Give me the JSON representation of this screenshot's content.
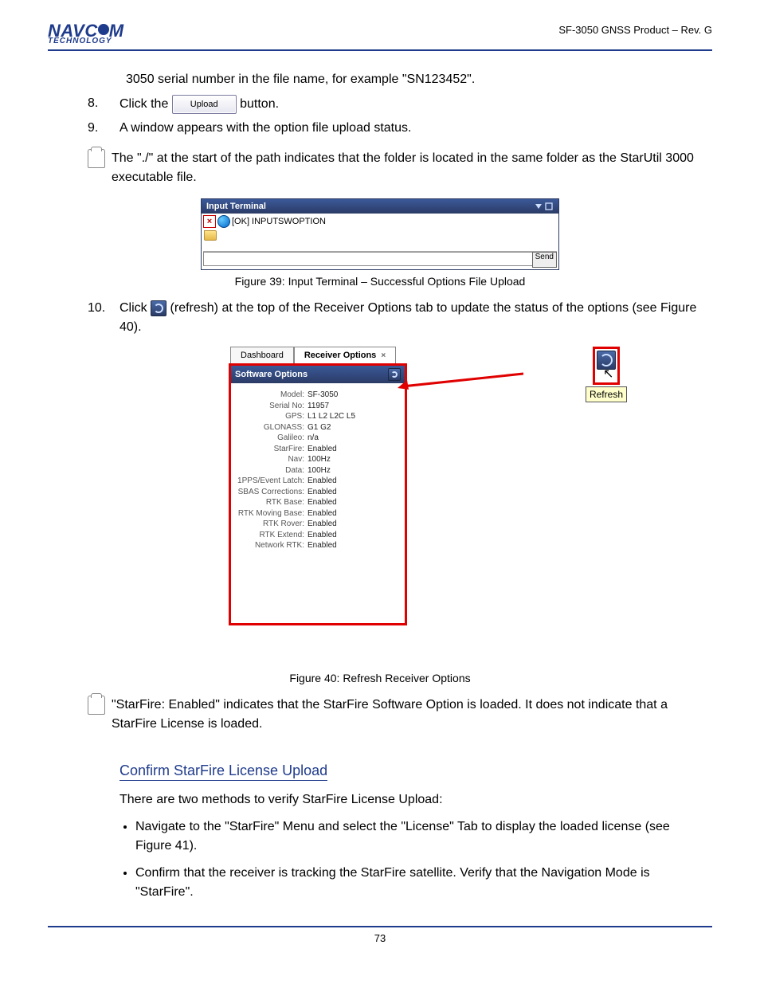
{
  "header": {
    "logo_top": "NAVC",
    "logo_top2": "M",
    "logo_bot": "TECHNOLOGY",
    "right": "SF-3050 GNSS Product – Rev. G"
  },
  "intro": "3050 serial number in the file name, for example \"SN123452\".",
  "steps": {
    "s8": {
      "num": "8.",
      "pre": "Click the ",
      "btn": "Upload",
      "post": " button."
    },
    "s9": {
      "num": "9.",
      "text": "A window appears with the option file upload status."
    },
    "s10": {
      "num": "10.",
      "text": "Click      (refresh) at the top of the Receiver Options tab to update the status of the options (see Figure 40)."
    }
  },
  "note1": "The \"./\" at the start of the path indicates that the folder is located in the same folder as the StarUtil 3000 executable file.",
  "fig39_caption": "Figure 39: Input Terminal – Successful Options File Upload",
  "terminal": {
    "title": "Input Terminal",
    "line1": "[OK] INPUTSWOPTION",
    "send": "Send"
  },
  "fig40_caption": "Figure 40: Refresh Receiver Options",
  "tabs": {
    "t1": "Dashboard",
    "t2": "Receiver Options"
  },
  "opt_title": "Software Options",
  "callout_label": "Refresh",
  "opts": [
    {
      "k": "Model:",
      "v": "SF-3050"
    },
    {
      "k": "Serial No:",
      "v": "11957"
    },
    {
      "k": "GPS:",
      "v": "L1 L2 L2C L5"
    },
    {
      "k": "GLONASS:",
      "v": "G1 G2"
    },
    {
      "k": "Galileo:",
      "v": "n/a"
    },
    {
      "k": "StarFire:",
      "v": "Enabled"
    },
    {
      "k": "Nav:",
      "v": "100Hz"
    },
    {
      "k": "Data:",
      "v": "100Hz"
    },
    {
      "k": "1PPS/Event Latch:",
      "v": "Enabled"
    },
    {
      "k": "SBAS Corrections:",
      "v": "Enabled"
    },
    {
      "k": "RTK Base:",
      "v": "Enabled"
    },
    {
      "k": "RTK Moving Base:",
      "v": "Enabled"
    },
    {
      "k": "RTK Rover:",
      "v": "Enabled"
    },
    {
      "k": "RTK Extend:",
      "v": "Enabled"
    },
    {
      "k": "Network RTK:",
      "v": "Enabled"
    }
  ],
  "note2": "\"StarFire: Enabled\" indicates that the StarFire Software Option is loaded. It does not indicate that a StarFire License is loaded.",
  "section_heading": "Confirm StarFire License Upload",
  "para1": "There are two methods to verify StarFire License Upload:",
  "bullets": [
    "Navigate to the \"StarFire\" Menu and select the \"License\" Tab to display the loaded license (see Figure 41).",
    "Confirm that the receiver is tracking the StarFire satellite. Verify that the Navigation Mode is \"StarFire\"."
  ],
  "footer_page": "73"
}
